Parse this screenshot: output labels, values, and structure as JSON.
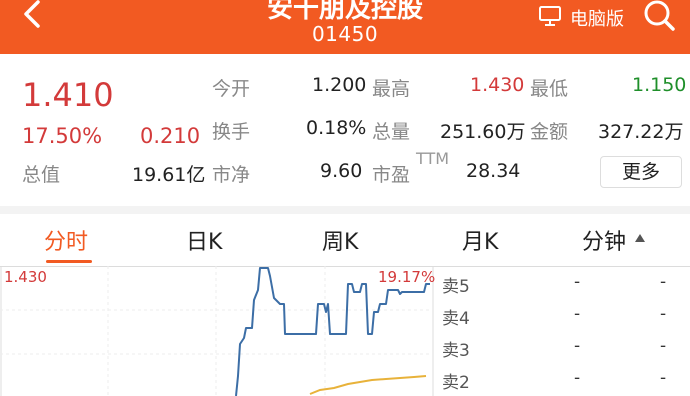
{
  "header": {
    "title": "安干朋及控股",
    "code": "01450",
    "desktop_label": "电脑版",
    "bg_color": "#f25a22"
  },
  "quote": {
    "price": "1.410",
    "change_pct": "17.50%",
    "change": "0.210",
    "fields": {
      "open_label": "今开",
      "open_value": "1.200",
      "high_label": "最高",
      "high_value": "1.430",
      "low_label": "最低",
      "low_value": "1.150",
      "turnover_label": "换手",
      "turnover_value": "0.18%",
      "volume_label": "总量",
      "volume_value": "251.60万",
      "amount_label": "金额",
      "amount_value": "327.22万",
      "mktcap_label": "总值",
      "mktcap_value": "19.61亿",
      "pb_label": "市净",
      "pb_value": "9.60",
      "pe_label": "市盈",
      "pe_sup": "TTM",
      "pe_value": "28.34"
    },
    "more_label": "更多",
    "up_color": "#d33a3a",
    "down_color": "#1f8f2a"
  },
  "tabs": [
    "分时",
    "日K",
    "周K",
    "月K",
    "分钟"
  ],
  "active_tab": "分时",
  "chart": {
    "max_price_label": "1.430",
    "max_pct_label": "19.17%"
  },
  "order_book": [
    {
      "name": "卖5",
      "price": "-",
      "volume": "-"
    },
    {
      "name": "卖4",
      "price": "-",
      "volume": "-"
    },
    {
      "name": "卖3",
      "price": "-",
      "volume": "-"
    },
    {
      "name": "卖2",
      "price": "-",
      "volume": "-"
    }
  ]
}
